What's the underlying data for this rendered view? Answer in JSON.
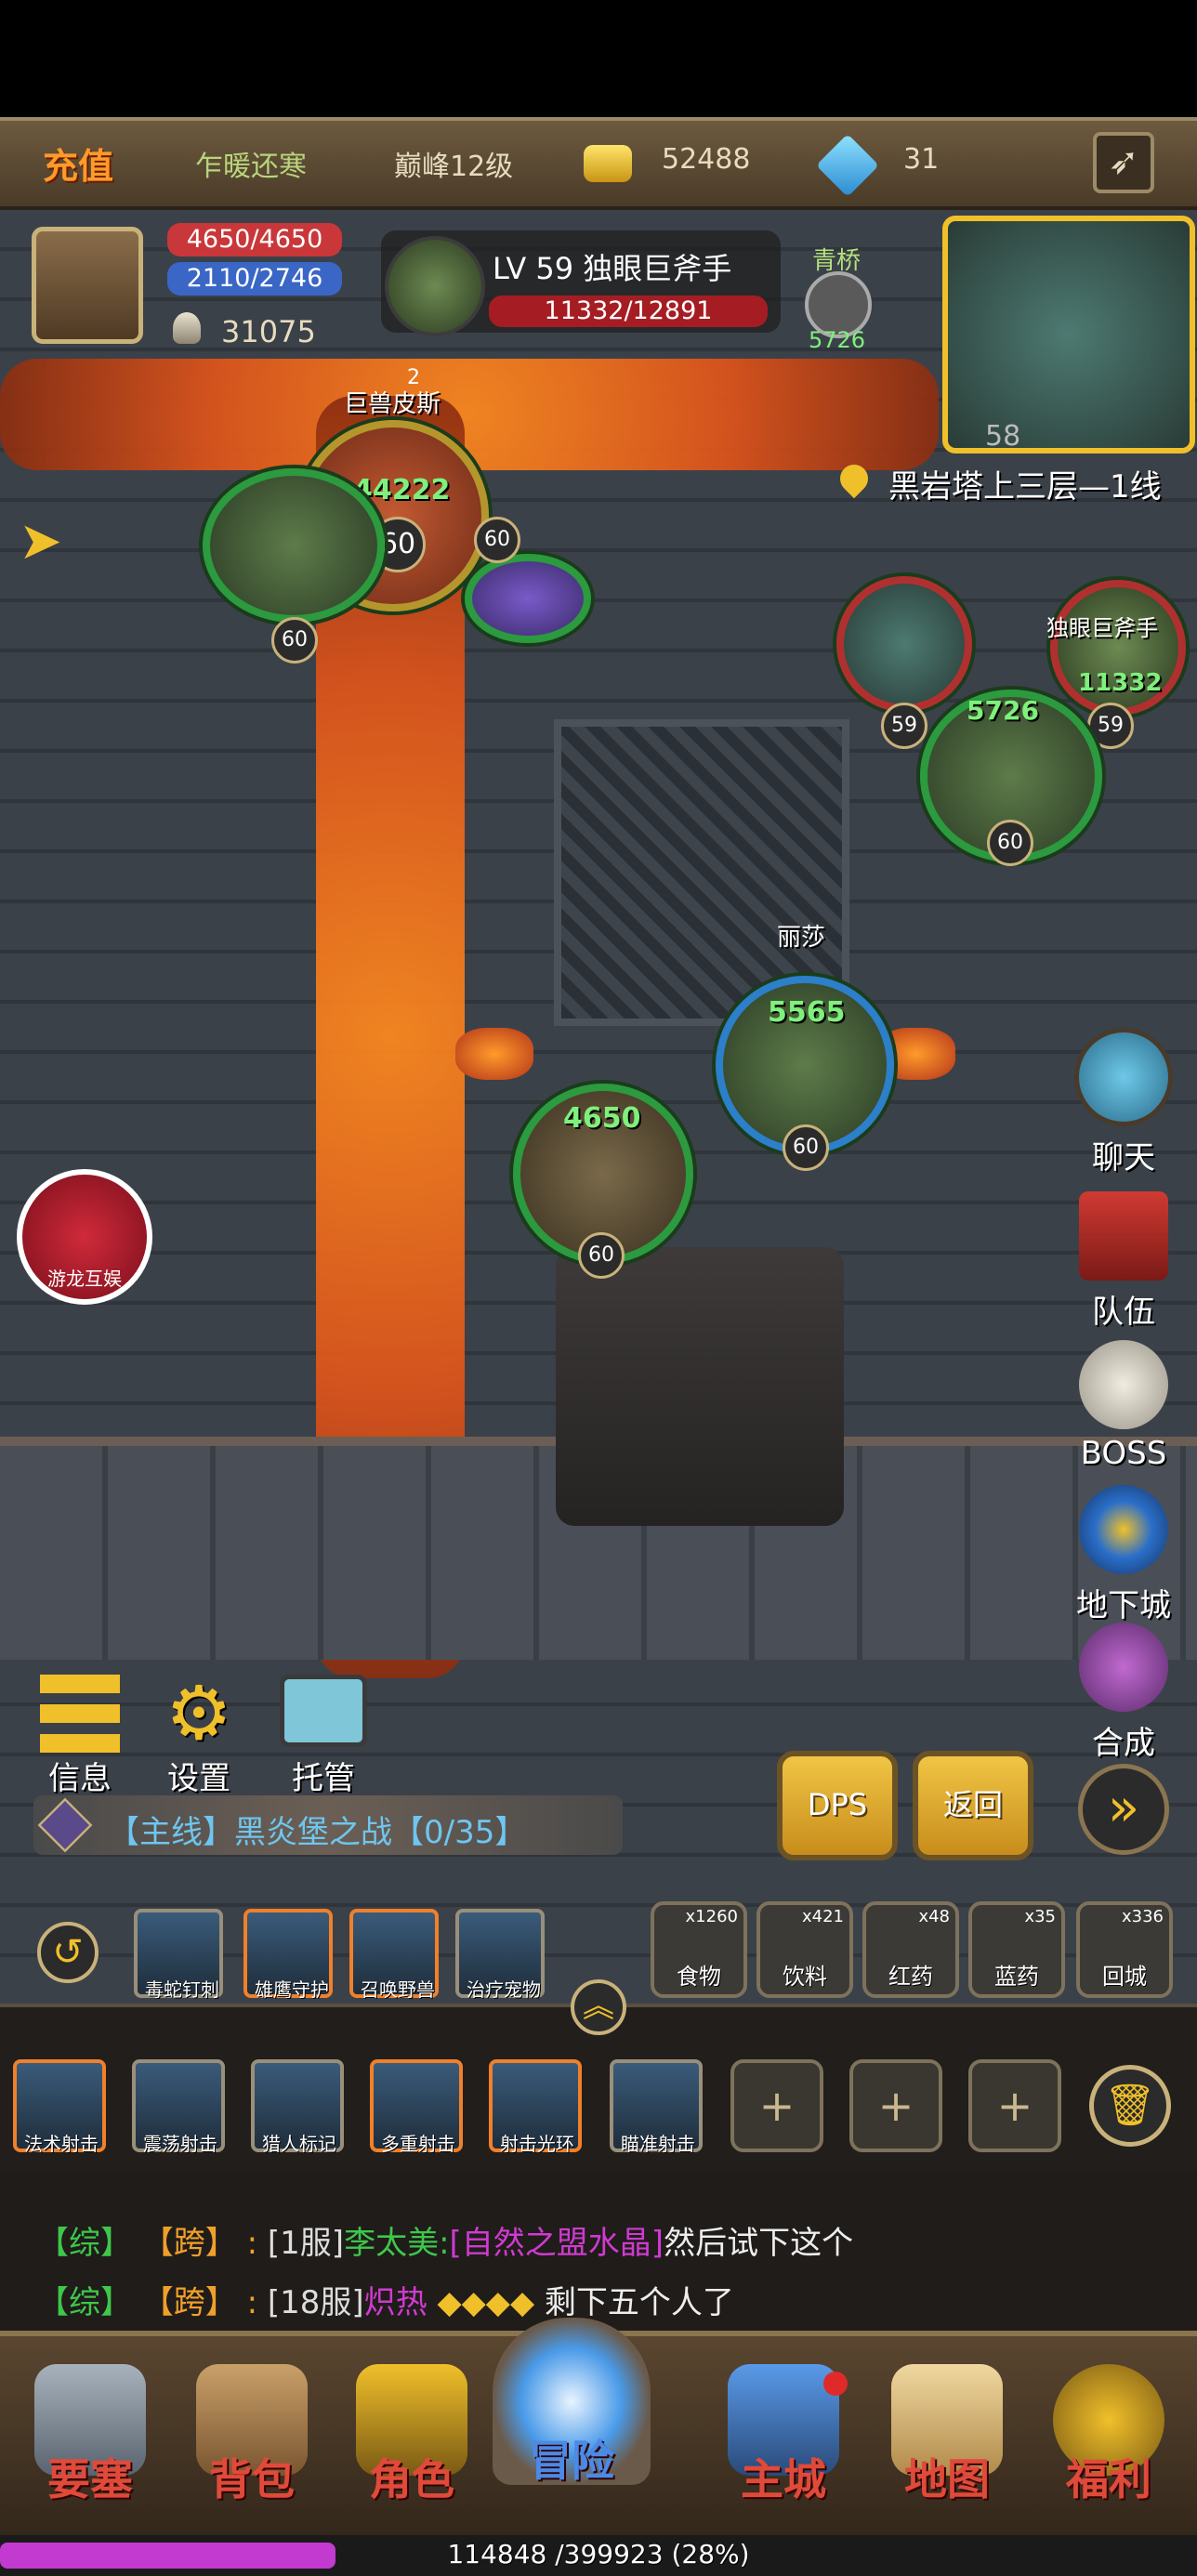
{
  "topbar": {
    "recharge": "充值",
    "season": "乍暖还寒",
    "rank": "巅峰12级",
    "gold": "52488",
    "diamonds": "31"
  },
  "player": {
    "hp": "4650/4650",
    "mp": "2110/2746",
    "power": "31075"
  },
  "target": {
    "title": "LV 59 独眼巨斧手",
    "hp": "11332/12891"
  },
  "ally_top": {
    "name": "青桥",
    "hp": "5726"
  },
  "location": "黑岩塔上三层—1线",
  "minimap": {
    "level": "58"
  },
  "units": {
    "pet": {
      "name": "巨兽皮斯",
      "hp": "44222",
      "level": "60",
      "badge": "2"
    },
    "left_hero": {
      "level": "60"
    },
    "purple": {
      "level": "60"
    },
    "enemy_right": {
      "name": "独眼巨斧手",
      "hp": "11332",
      "level_a": "59",
      "level_b": "59"
    },
    "qingqiao": {
      "hp": "5726",
      "level": "60"
    },
    "lisha": {
      "name": "丽莎",
      "hp": "5565",
      "level": "60"
    },
    "self": {
      "hp": "4650",
      "level": "60"
    }
  },
  "side": {
    "chat": "聊天",
    "team": "队伍",
    "boss": "BOSS",
    "dungeon": "地下城",
    "craft": "合成"
  },
  "logo": "游龙互娱",
  "quick": {
    "info": "信息",
    "settings": "设置",
    "auto": "托管"
  },
  "quest": "【主线】黑炎堡之战【0/35】",
  "buttons": {
    "dps": "DPS",
    "return": "返回"
  },
  "pet_skills": [
    "毒蛇钉刺",
    "雄鹰守护",
    "召唤野兽",
    "治疗宠物"
  ],
  "items": [
    {
      "label": "食物",
      "count": "x1260"
    },
    {
      "label": "饮料",
      "count": "x421"
    },
    {
      "label": "红药",
      "count": "x48"
    },
    {
      "label": "蓝药",
      "count": "x35"
    },
    {
      "label": "回城",
      "count": "x336"
    }
  ],
  "skills": [
    "法术射击",
    "震荡射击",
    "猎人标记",
    "多重射击",
    "射击光环",
    "瞄准射击"
  ],
  "chat": [
    {
      "tag1": "【综】",
      "tag2": "【跨】",
      "sep": ":",
      "server": "[1服]",
      "name": "李太美:",
      "item": "[自然之盟水晶]",
      "rest": "然后试下这个"
    },
    {
      "tag1": "【综】",
      "tag2": "【跨】",
      "sep": ":",
      "server": "[18服]",
      "name": "炽热",
      "rest": "剩下五个人了"
    }
  ],
  "nav": [
    "要塞",
    "背包",
    "角色",
    "冒险",
    "主城",
    "地图",
    "福利"
  ],
  "xp": {
    "text": "114848 /399923 (28%)",
    "fraction": 0.28
  },
  "colors": {
    "gold": "#f0c545",
    "hp_green": "#7ff07b",
    "nav_red": "#e04a3a"
  }
}
